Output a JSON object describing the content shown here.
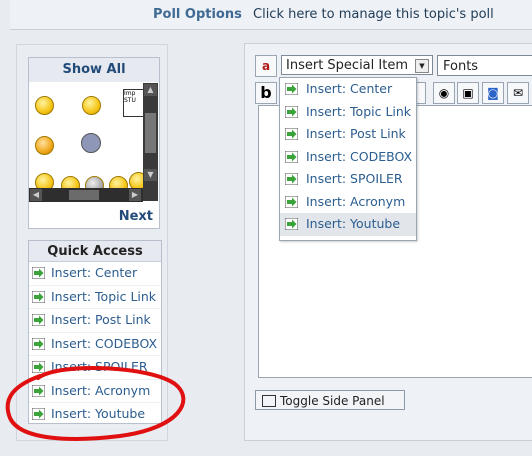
{
  "poll": {
    "label": "Poll Options",
    "link": "Click here to manage this topic's poll"
  },
  "emoticons": {
    "show_all": "Show All",
    "next": "Next"
  },
  "quick_access": {
    "title": "Quick Access",
    "items": [
      "Insert: Center",
      "Insert: Topic Link",
      "Insert: Post Link",
      "Insert: CODEBOX",
      "Insert: SPOILER",
      "Insert: Acronym",
      "Insert: Youtube"
    ]
  },
  "toolbar": {
    "special_select": "Insert Special Item",
    "fonts_select": "Fonts",
    "bold": "b"
  },
  "dropdown": {
    "items": [
      "Insert: Center",
      "Insert: Topic Link",
      "Insert: Post Link",
      "Insert: CODEBOX",
      "Insert: SPOILER",
      "Insert: Acronym",
      "Insert: Youtube"
    ],
    "highlighted": "Insert: Youtube"
  },
  "toggle_side_panel": "Toggle Side Panel",
  "colors": {
    "link": "#2b5d8f",
    "header": "#234b7a",
    "annotation": "#e01010",
    "arrow": "#3aa43a"
  }
}
